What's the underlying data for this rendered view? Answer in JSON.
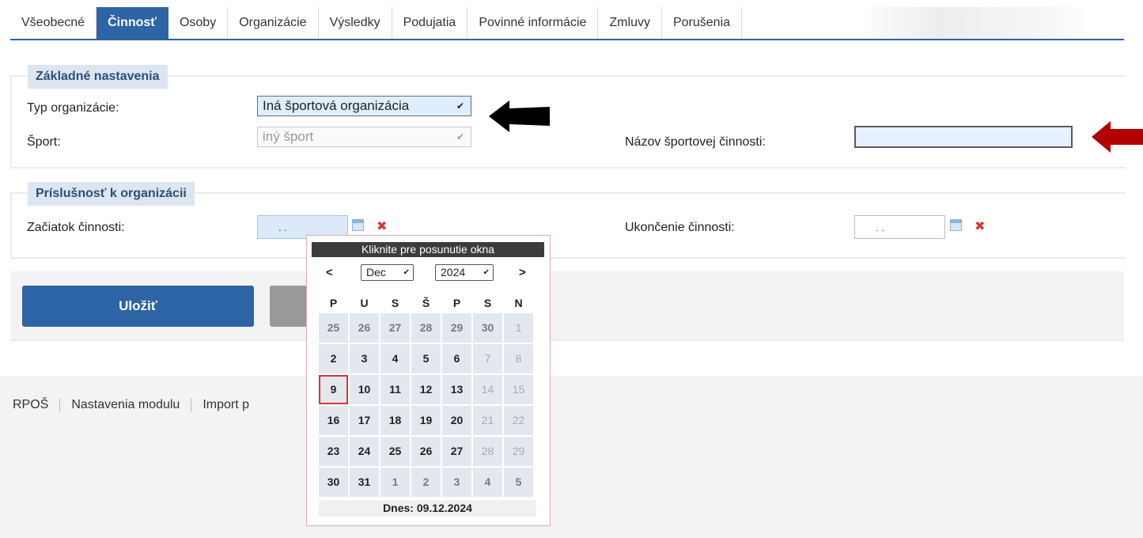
{
  "tabs": [
    {
      "label": "Všeobecné",
      "active": false
    },
    {
      "label": "Činnosť",
      "active": true
    },
    {
      "label": "Osoby",
      "active": false
    },
    {
      "label": "Organizácie",
      "active": false
    },
    {
      "label": "Výsledky",
      "active": false
    },
    {
      "label": "Podujatia",
      "active": false
    },
    {
      "label": "Povinné informácie",
      "active": false
    },
    {
      "label": "Zmluvy",
      "active": false
    },
    {
      "label": "Porušenia",
      "active": false
    }
  ],
  "basic": {
    "legend": "Základné nastavenia",
    "org_type_label": "Typ organizácie:",
    "org_type_value": "Iná športová organizácia",
    "sport_label": "Šport:",
    "sport_value": "iný šport",
    "activity_name_label": "Názov športovej činnosti:",
    "activity_name_value": ""
  },
  "membership": {
    "legend": "Príslušnosť k organizácii",
    "start_label": "Začiatok činnosti:",
    "start_value": ". .",
    "end_label": "Ukončenie činnosti:",
    "end_value": ". ."
  },
  "actions": {
    "save_label": "Uložiť"
  },
  "footer": {
    "links": [
      "RPOŠ",
      "Nastavenia modulu",
      "Import p"
    ]
  },
  "calendar": {
    "header": "Kliknite pre posunutie okna",
    "prev": "<",
    "next": ">",
    "month": "Dec",
    "year": "2024",
    "weekdays": [
      "P",
      "U",
      "S",
      "Š",
      "P",
      "S",
      "N"
    ],
    "weeks": [
      [
        "25",
        "26",
        "27",
        "28",
        "29",
        "30",
        "1"
      ],
      [
        "2",
        "3",
        "4",
        "5",
        "6",
        "7",
        "8"
      ],
      [
        "9",
        "10",
        "11",
        "12",
        "13",
        "14",
        "15"
      ],
      [
        "16",
        "17",
        "18",
        "19",
        "20",
        "21",
        "22"
      ],
      [
        "23",
        "24",
        "25",
        "26",
        "27",
        "28",
        "29"
      ],
      [
        "30",
        "31",
        "1",
        "2",
        "3",
        "4",
        "5"
      ]
    ],
    "today_label": "Dnes: 09.12.2024"
  },
  "colors": {
    "accent": "#2d64a5",
    "annotation_black": "#000000",
    "annotation_red": "#b30000"
  },
  "icons": [
    "calendar-icon",
    "clear-icon",
    "chevron-down-icon",
    "arrow-left-icon"
  ]
}
